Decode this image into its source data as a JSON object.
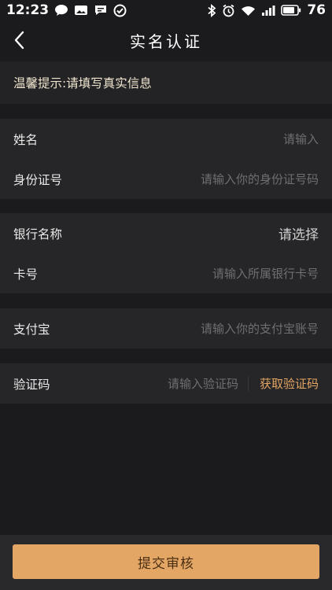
{
  "status_bar": {
    "time": "12:23",
    "battery": "76"
  },
  "header": {
    "title": "实名认证"
  },
  "tip": {
    "text": "温馨提示:请填写真实信息"
  },
  "form": {
    "name": {
      "label": "姓名",
      "placeholder": "请输入"
    },
    "id_number": {
      "label": "身份证号",
      "placeholder": "请输入你的身份证号码"
    },
    "bank_name": {
      "label": "银行名称",
      "value": "请选择"
    },
    "card_number": {
      "label": "卡号",
      "placeholder": "请输入所属银行卡号"
    },
    "alipay": {
      "label": "支付宝",
      "placeholder": "请输入你的支付宝账号"
    },
    "verify_code": {
      "label": "验证码",
      "placeholder": "请输入验证码",
      "get_code": "获取验证码"
    }
  },
  "submit": {
    "label": "提交审核"
  },
  "colors": {
    "accent": "#e3a665",
    "background": "#1b1b1d",
    "card": "#262628"
  }
}
